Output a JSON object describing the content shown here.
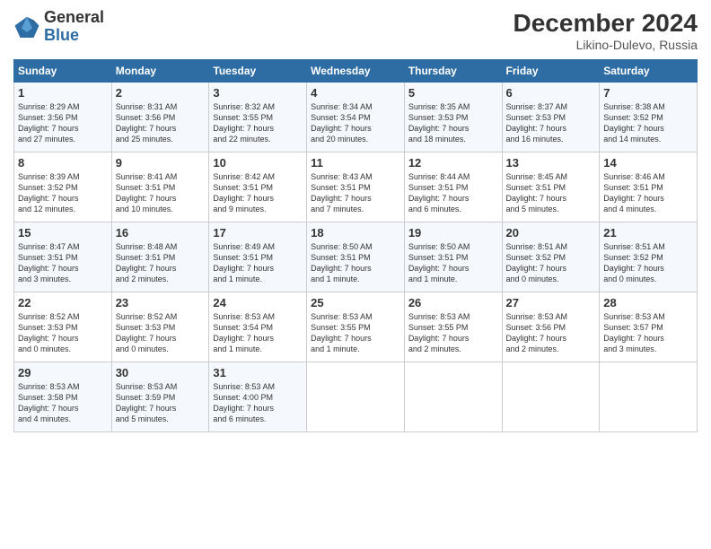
{
  "header": {
    "logo_general": "General",
    "logo_blue": "Blue",
    "month": "December 2024",
    "location": "Likino-Dulevo, Russia"
  },
  "days_of_week": [
    "Sunday",
    "Monday",
    "Tuesday",
    "Wednesday",
    "Thursday",
    "Friday",
    "Saturday"
  ],
  "weeks": [
    [
      {
        "day": "1",
        "info": "Sunrise: 8:29 AM\nSunset: 3:56 PM\nDaylight: 7 hours\nand 27 minutes."
      },
      {
        "day": "2",
        "info": "Sunrise: 8:31 AM\nSunset: 3:56 PM\nDaylight: 7 hours\nand 25 minutes."
      },
      {
        "day": "3",
        "info": "Sunrise: 8:32 AM\nSunset: 3:55 PM\nDaylight: 7 hours\nand 22 minutes."
      },
      {
        "day": "4",
        "info": "Sunrise: 8:34 AM\nSunset: 3:54 PM\nDaylight: 7 hours\nand 20 minutes."
      },
      {
        "day": "5",
        "info": "Sunrise: 8:35 AM\nSunset: 3:53 PM\nDaylight: 7 hours\nand 18 minutes."
      },
      {
        "day": "6",
        "info": "Sunrise: 8:37 AM\nSunset: 3:53 PM\nDaylight: 7 hours\nand 16 minutes."
      },
      {
        "day": "7",
        "info": "Sunrise: 8:38 AM\nSunset: 3:52 PM\nDaylight: 7 hours\nand 14 minutes."
      }
    ],
    [
      {
        "day": "8",
        "info": "Sunrise: 8:39 AM\nSunset: 3:52 PM\nDaylight: 7 hours\nand 12 minutes."
      },
      {
        "day": "9",
        "info": "Sunrise: 8:41 AM\nSunset: 3:51 PM\nDaylight: 7 hours\nand 10 minutes."
      },
      {
        "day": "10",
        "info": "Sunrise: 8:42 AM\nSunset: 3:51 PM\nDaylight: 7 hours\nand 9 minutes."
      },
      {
        "day": "11",
        "info": "Sunrise: 8:43 AM\nSunset: 3:51 PM\nDaylight: 7 hours\nand 7 minutes."
      },
      {
        "day": "12",
        "info": "Sunrise: 8:44 AM\nSunset: 3:51 PM\nDaylight: 7 hours\nand 6 minutes."
      },
      {
        "day": "13",
        "info": "Sunrise: 8:45 AM\nSunset: 3:51 PM\nDaylight: 7 hours\nand 5 minutes."
      },
      {
        "day": "14",
        "info": "Sunrise: 8:46 AM\nSunset: 3:51 PM\nDaylight: 7 hours\nand 4 minutes."
      }
    ],
    [
      {
        "day": "15",
        "info": "Sunrise: 8:47 AM\nSunset: 3:51 PM\nDaylight: 7 hours\nand 3 minutes."
      },
      {
        "day": "16",
        "info": "Sunrise: 8:48 AM\nSunset: 3:51 PM\nDaylight: 7 hours\nand 2 minutes."
      },
      {
        "day": "17",
        "info": "Sunrise: 8:49 AM\nSunset: 3:51 PM\nDaylight: 7 hours\nand 1 minute."
      },
      {
        "day": "18",
        "info": "Sunrise: 8:50 AM\nSunset: 3:51 PM\nDaylight: 7 hours\nand 1 minute."
      },
      {
        "day": "19",
        "info": "Sunrise: 8:50 AM\nSunset: 3:51 PM\nDaylight: 7 hours\nand 1 minute."
      },
      {
        "day": "20",
        "info": "Sunrise: 8:51 AM\nSunset: 3:52 PM\nDaylight: 7 hours\nand 0 minutes."
      },
      {
        "day": "21",
        "info": "Sunrise: 8:51 AM\nSunset: 3:52 PM\nDaylight: 7 hours\nand 0 minutes."
      }
    ],
    [
      {
        "day": "22",
        "info": "Sunrise: 8:52 AM\nSunset: 3:53 PM\nDaylight: 7 hours\nand 0 minutes."
      },
      {
        "day": "23",
        "info": "Sunrise: 8:52 AM\nSunset: 3:53 PM\nDaylight: 7 hours\nand 0 minutes."
      },
      {
        "day": "24",
        "info": "Sunrise: 8:53 AM\nSunset: 3:54 PM\nDaylight: 7 hours\nand 1 minute."
      },
      {
        "day": "25",
        "info": "Sunrise: 8:53 AM\nSunset: 3:55 PM\nDaylight: 7 hours\nand 1 minute."
      },
      {
        "day": "26",
        "info": "Sunrise: 8:53 AM\nSunset: 3:55 PM\nDaylight: 7 hours\nand 2 minutes."
      },
      {
        "day": "27",
        "info": "Sunrise: 8:53 AM\nSunset: 3:56 PM\nDaylight: 7 hours\nand 2 minutes."
      },
      {
        "day": "28",
        "info": "Sunrise: 8:53 AM\nSunset: 3:57 PM\nDaylight: 7 hours\nand 3 minutes."
      }
    ],
    [
      {
        "day": "29",
        "info": "Sunrise: 8:53 AM\nSunset: 3:58 PM\nDaylight: 7 hours\nand 4 minutes."
      },
      {
        "day": "30",
        "info": "Sunrise: 8:53 AM\nSunset: 3:59 PM\nDaylight: 7 hours\nand 5 minutes."
      },
      {
        "day": "31",
        "info": "Sunrise: 8:53 AM\nSunset: 4:00 PM\nDaylight: 7 hours\nand 6 minutes."
      },
      null,
      null,
      null,
      null
    ]
  ]
}
